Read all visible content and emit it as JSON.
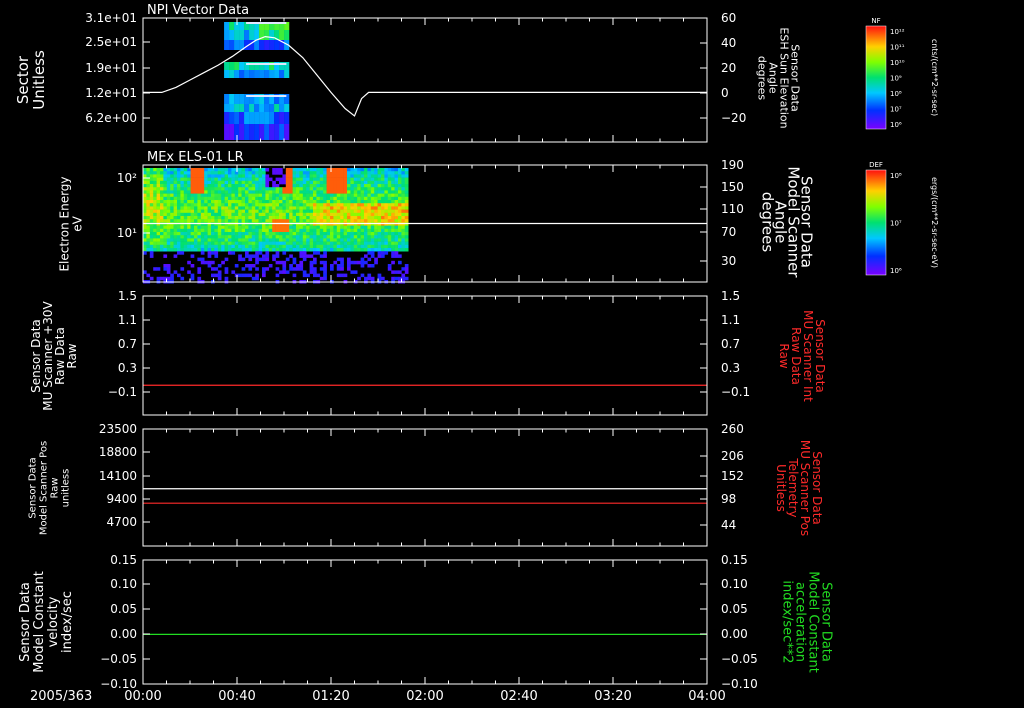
{
  "date_label": "2005/363",
  "time_ticks": [
    "00:00",
    "00:40",
    "01:20",
    "02:00",
    "02:40",
    "03:20",
    "04:00"
  ],
  "chart_data": [
    {
      "type": "heatmap+line",
      "title": "NPI Vector Data",
      "ylabel": [
        "Sector",
        "Unitless"
      ],
      "yticks": [
        "3.1e+01",
        "2.5e+01",
        "1.9e+01",
        "1.2e+01",
        "6.2e+00"
      ],
      "right_ylabel": [
        "Sensor Data",
        "ESH Sun Elevation",
        "Angle",
        "degrees"
      ],
      "right_yticks": [
        "60",
        "40",
        "20",
        "0",
        "−20"
      ],
      "right_ylim": [
        -40,
        60
      ],
      "line_series": {
        "name": "ESH Sun Elevation Angle",
        "color": "#ffffff",
        "x": [
          0,
          8,
          14,
          20,
          26,
          32,
          38,
          44,
          48,
          52,
          56,
          62,
          68,
          74,
          80,
          86,
          90,
          93,
          96,
          100,
          120,
          160,
          200,
          240
        ],
        "y": [
          0,
          0,
          4,
          10,
          16,
          22,
          29,
          37,
          42,
          45,
          44,
          38,
          28,
          14,
          0,
          -13,
          -19,
          -5,
          0,
          0,
          0,
          0,
          0,
          0
        ]
      },
      "colorbar": {
        "label": "NF",
        "units": "cnts/(cm**2-sr-sec)",
        "ticks": [
          "10¹²",
          "10¹¹",
          "10¹⁰",
          "10⁹",
          "10⁸",
          "10⁷",
          "10⁶"
        ]
      }
    },
    {
      "type": "heatmap+line",
      "title": "MEx ELS-01 LR",
      "ylabel": [
        "Electron Energy",
        "eV"
      ],
      "yticks": [
        "10²",
        "10¹"
      ],
      "right_ylabel": [
        "Sensor Data",
        "Model Scanner",
        "Angle",
        "degrees"
      ],
      "right_yticks": [
        "190",
        "150",
        "110",
        "70",
        "30"
      ],
      "right_ylim": [
        0,
        190
      ],
      "line_series": {
        "name": "Model Scanner Angle",
        "color": "#ffffff",
        "x": [
          0,
          240
        ],
        "y": [
          95,
          95
        ]
      },
      "data_extent_minutes": 112,
      "colorbar": {
        "label": "DEF",
        "units": "ergs/(cm**2-sr-sec-eV)",
        "ticks": [
          "10⁸",
          "10⁷",
          "10⁶"
        ]
      }
    },
    {
      "type": "line",
      "ylabel": [
        "Sensor Data",
        "MU Scanner +30V",
        "Raw Data",
        "Raw"
      ],
      "yticks": [
        "1.5",
        "1.1",
        "0.7",
        "0.3",
        "−0.1"
      ],
      "ylim": [
        -0.5,
        1.5
      ],
      "right_ylabel": [
        "Sensor Data",
        "MU Scanner Int",
        "Raw Data",
        "Raw"
      ],
      "right_yticks": [
        "1.5",
        "1.1",
        "0.7",
        "0.3",
        "−0.1"
      ],
      "series": [
        {
          "name": "MU Scanner Int Raw Data",
          "color": "#ff2a2a",
          "y": 0.0
        }
      ]
    },
    {
      "type": "line",
      "ylabel": [
        "Sensor Data",
        "Model Scanner Pos",
        "Raw",
        "unitless"
      ],
      "yticks": [
        "23500",
        "18800",
        "14100",
        "9400",
        "4700"
      ],
      "ylim": [
        0,
        23500
      ],
      "right_ylabel": [
        "Sensor Data",
        "MU Scanner Pos",
        "Telemetry",
        "Unitless"
      ],
      "right_yticks": [
        "260",
        "206",
        "152",
        "98",
        "44"
      ],
      "series": [
        {
          "name": "Model Scanner Pos Raw",
          "color": "#ffffff",
          "y": 11500
        },
        {
          "name": "MU Scanner Pos Telemetry",
          "color": "#ff2a2a",
          "y": 8600
        }
      ]
    },
    {
      "type": "line",
      "ylabel": [
        "Sensor Data",
        "Model Constant",
        "velocity",
        "index/sec"
      ],
      "yticks": [
        "0.15",
        "0.10",
        "0.05",
        "0.00",
        "−0.05",
        "−0.10"
      ],
      "ylim": [
        -0.1,
        0.15
      ],
      "right_ylabel": [
        "Sensor Data",
        "Model Constant",
        "acceleration",
        "index/sec**2"
      ],
      "right_yticks": [
        "0.15",
        "0.10",
        "0.05",
        "0.00",
        "−0.05",
        "−0.10"
      ],
      "series": [
        {
          "name": "Model Constant acceleration",
          "color": "#22dd22",
          "y": 0.0
        }
      ]
    }
  ]
}
